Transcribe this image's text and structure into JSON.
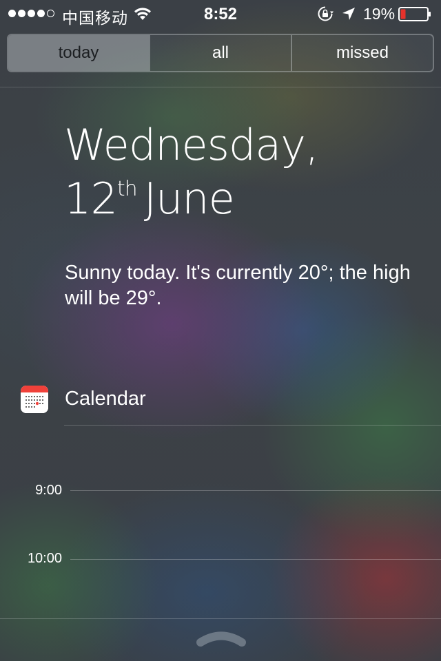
{
  "status_bar": {
    "carrier": "中国移动",
    "time": "8:52",
    "battery_percent": "19%",
    "signal_bars_filled": 4,
    "signal_bars_total": 5,
    "battery_level": 0.19,
    "battery_color": "#e8322b"
  },
  "tabs": [
    {
      "label": "today",
      "selected": true
    },
    {
      "label": "all",
      "selected": false
    },
    {
      "label": "missed",
      "selected": false
    }
  ],
  "date": {
    "line1": "Wednesday,",
    "day": "12",
    "suffix": "th",
    "month": "June"
  },
  "weather": {
    "text": "Sunny today. It's currently 20°; the high will be 29°."
  },
  "calendar": {
    "title": "Calendar",
    "icon": "calendar-app-icon",
    "hours": [
      "9:00",
      "10:00"
    ]
  },
  "icons": {
    "wifi": "wifi-icon",
    "rotation_lock": "rotation-lock-icon",
    "location": "location-arrow-icon",
    "battery": "battery-icon",
    "grabber": "chevron-up-grabber-icon"
  }
}
